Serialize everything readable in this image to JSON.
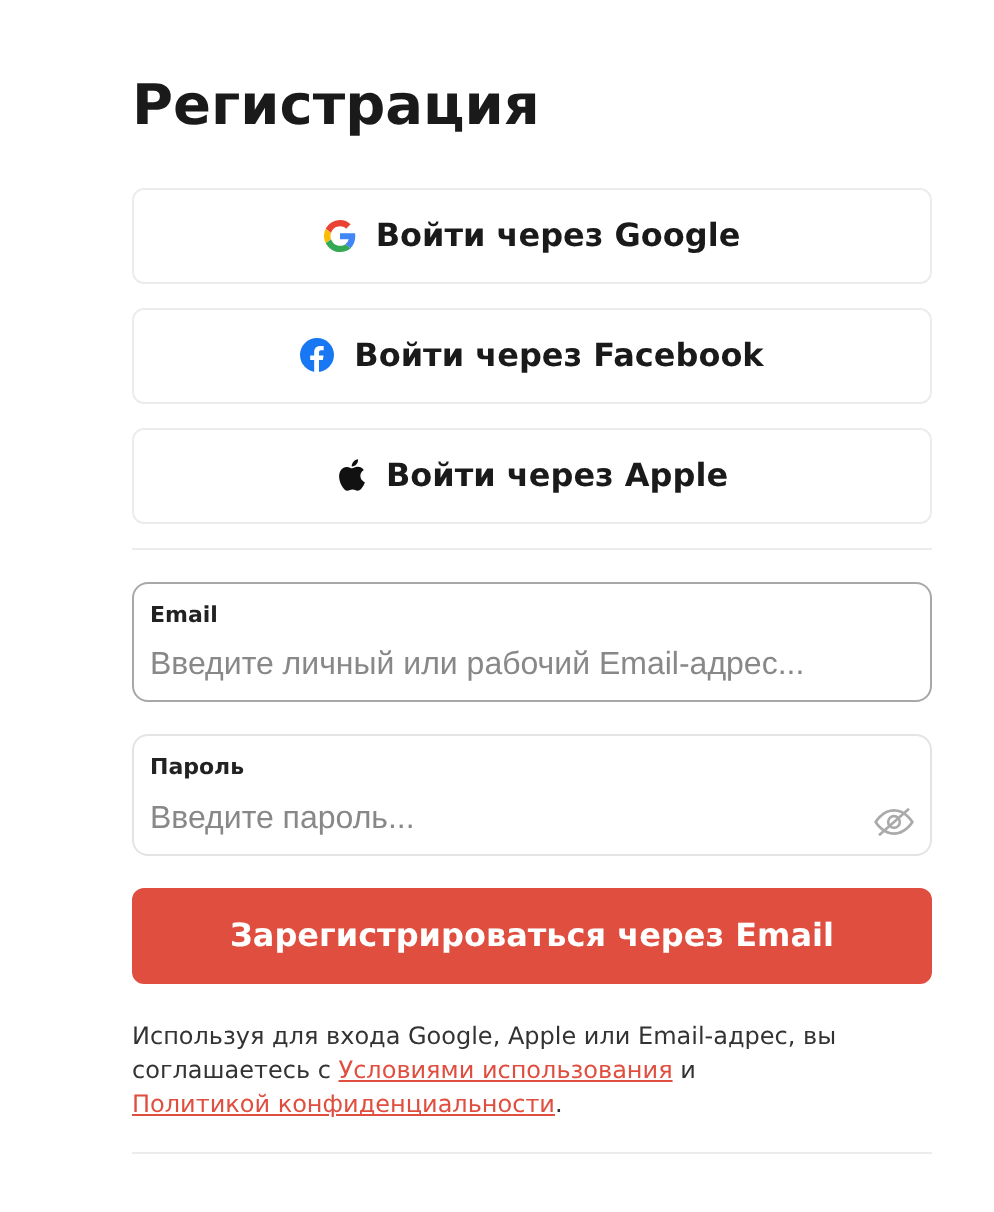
{
  "title": "Регистрация",
  "social_buttons": [
    {
      "kind": "google",
      "label": "Войти через Google"
    },
    {
      "kind": "facebook",
      "label": "Войти через Facebook"
    },
    {
      "kind": "apple",
      "label": "Войти через Apple"
    }
  ],
  "fields": [
    {
      "kind": "email",
      "label": "Email",
      "placeholder": "Введите личный или рабочий Email-адрес...",
      "focused": true
    },
    {
      "kind": "password",
      "label": "Пароль",
      "placeholder": "Введите пароль...",
      "focused": false
    }
  ],
  "submit": "Зарегистрироваться через Email",
  "consent": [
    {
      "kind": "text",
      "text": "Используя для входа Google, Apple или Email-адрес, вы соглашаетесь с "
    },
    {
      "kind": "link",
      "text": "Условиями использования"
    },
    {
      "kind": "text",
      "text": " и "
    },
    {
      "kind": "link",
      "text": "Политикой конфиденциальности"
    },
    {
      "kind": "text",
      "text": "."
    }
  ]
}
